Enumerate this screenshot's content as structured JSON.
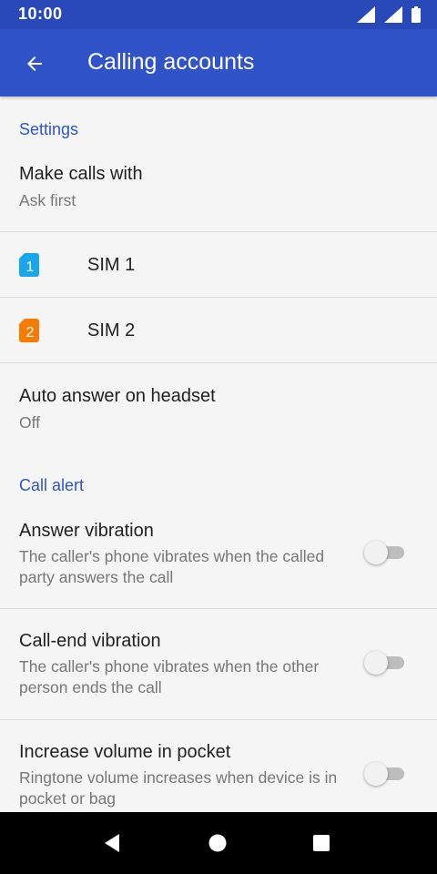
{
  "status": {
    "time": "10:00"
  },
  "appbar": {
    "title": "Calling accounts"
  },
  "sections": {
    "settings": "Settings",
    "call_alert": "Call alert"
  },
  "make_calls": {
    "title": "Make calls with",
    "value": "Ask first"
  },
  "sims": [
    {
      "label": "SIM 1",
      "badge": "1",
      "color": "#1aa6ea"
    },
    {
      "label": "SIM 2",
      "badge": "2",
      "color": "#f57c00"
    }
  ],
  "auto_answer": {
    "title": "Auto answer on headset",
    "value": "Off"
  },
  "toggles": [
    {
      "title": "Answer vibration",
      "summary": "The caller's phone vibrates when the called party answers the call",
      "on": false
    },
    {
      "title": "Call-end vibration",
      "summary": "The caller's phone vibrates when the other person ends the call",
      "on": false
    },
    {
      "title": "Increase volume in pocket",
      "summary": "Ringtone volume increases when device is in pocket or bag",
      "on": false
    }
  ],
  "colors": {
    "statusbar": "#2a49b8",
    "appbar": "#3053c8",
    "accent": "#2e56c0"
  }
}
